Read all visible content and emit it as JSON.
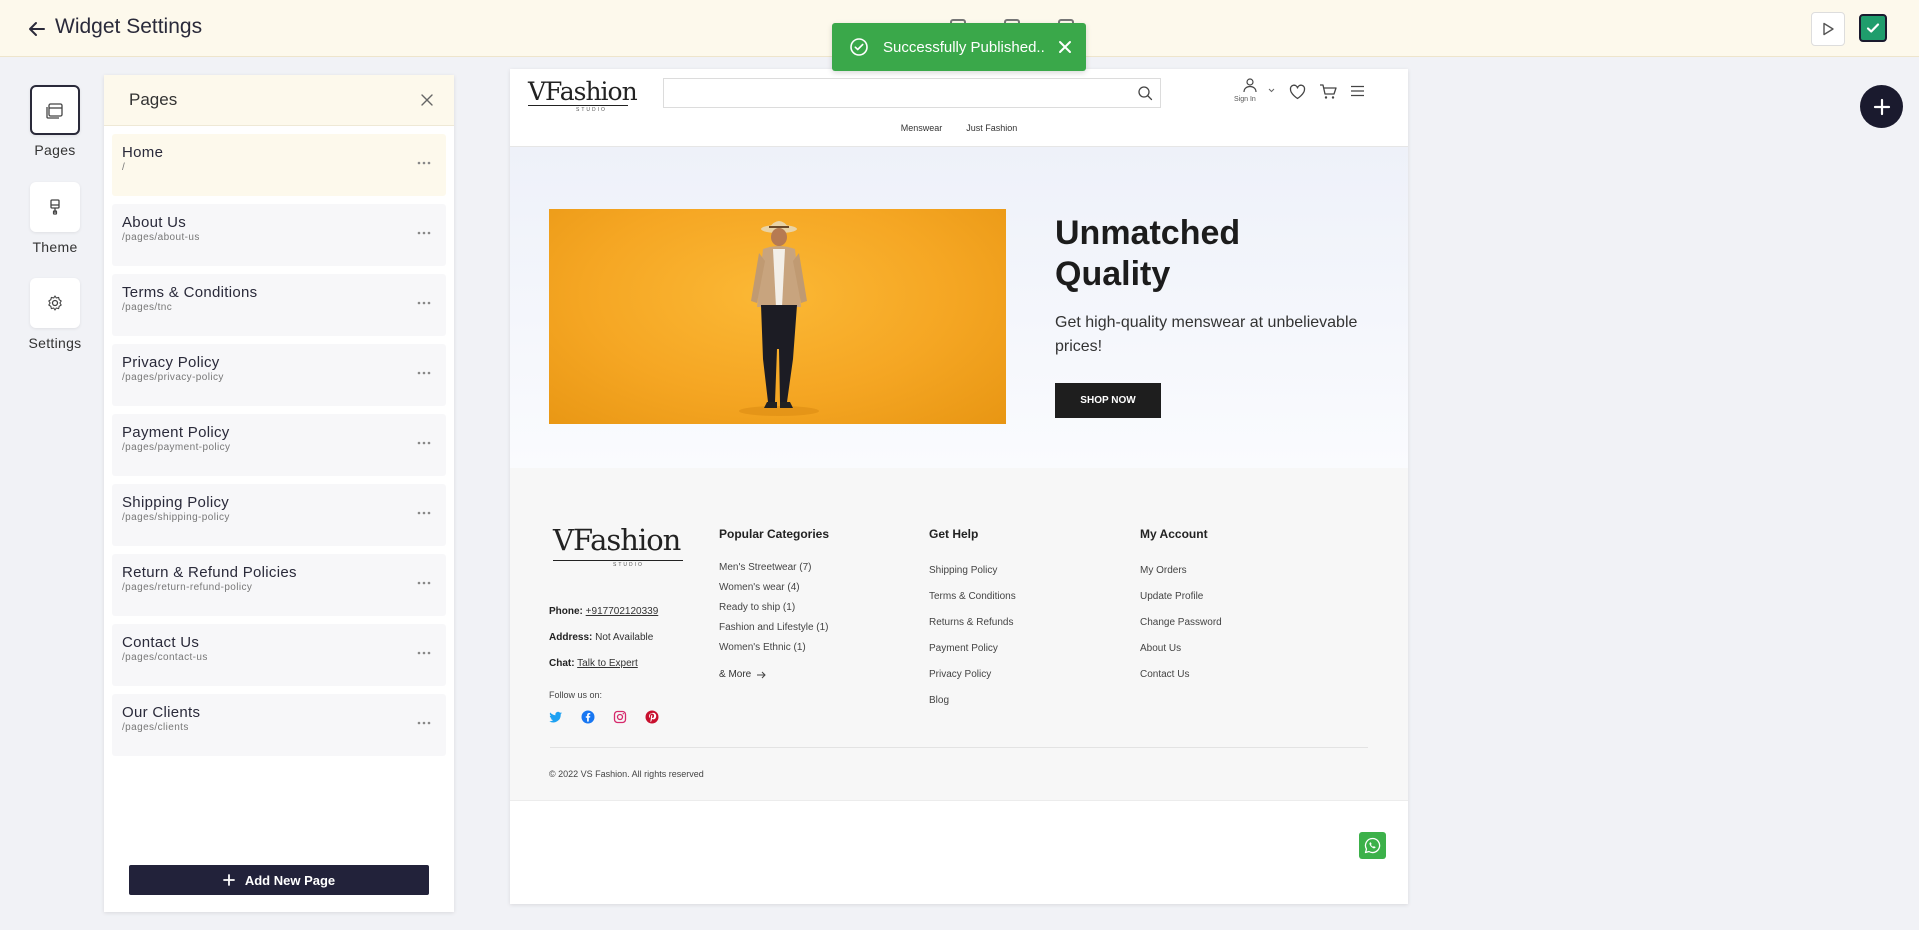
{
  "topbar": {
    "title": "Widget Settings",
    "back_icon": "arrow-left-icon",
    "play_icon": "play-icon",
    "publish_icon": "check-icon",
    "accent": "#1f9d6c"
  },
  "toast": {
    "message": "Successfully Published..",
    "color": "#3aa84a"
  },
  "rail": {
    "items": [
      {
        "label": "Pages",
        "icon": "pages-icon"
      },
      {
        "label": "Theme",
        "icon": "brush-icon"
      },
      {
        "label": "Settings",
        "icon": "gear-icon"
      }
    ]
  },
  "pages_panel": {
    "title": "Pages",
    "add_button": "Add New Page",
    "items": [
      {
        "name": "Home",
        "path": "/"
      },
      {
        "name": "About Us",
        "path": "/pages/about-us"
      },
      {
        "name": "Terms & Conditions",
        "path": "/pages/tnc"
      },
      {
        "name": "Privacy Policy",
        "path": "/pages/privacy-policy"
      },
      {
        "name": "Payment Policy",
        "path": "/pages/payment-policy"
      },
      {
        "name": "Shipping Policy",
        "path": "/pages/shipping-policy"
      },
      {
        "name": "Return & Refund Policies",
        "path": "/pages/return-refund-policy"
      },
      {
        "name": "Contact Us",
        "path": "/pages/contact-us"
      },
      {
        "name": "Our Clients",
        "path": "/pages/clients"
      }
    ]
  },
  "preview": {
    "logo": "VFashion",
    "logo_sub": "STUDIO",
    "sign_in": "Sign In",
    "nav": [
      "Menswear",
      "Just Fashion"
    ],
    "hero": {
      "title": "Unmatched Quality",
      "subtitle": "Get high-quality menswear at unbelievable prices!",
      "button": "SHOP NOW"
    },
    "footer": {
      "phone_label": "Phone:",
      "phone": "+917702120339",
      "address_label": "Address:",
      "address": "Not Available",
      "chat_label": "Chat:",
      "chat": "Talk to Expert",
      "follow": "Follow us on:",
      "copyright": "© 2022 VS Fashion. All rights reserved",
      "popular": {
        "title": "Popular Categories",
        "items": [
          "Men's Streetwear (7)",
          "Women's wear (4)",
          "Ready to ship (1)",
          "Fashion and Lifestyle (1)",
          "Women's Ethnic (1)"
        ],
        "more": "& More"
      },
      "help": {
        "title": "Get Help",
        "items": [
          "Shipping Policy",
          "Terms & Conditions",
          "Returns & Refunds",
          "Payment Policy",
          "Privacy Policy",
          "Blog"
        ]
      },
      "account": {
        "title": "My Account",
        "items": [
          "My Orders",
          "Update Profile",
          "Change Password",
          "About Us",
          "Contact Us"
        ]
      }
    }
  }
}
